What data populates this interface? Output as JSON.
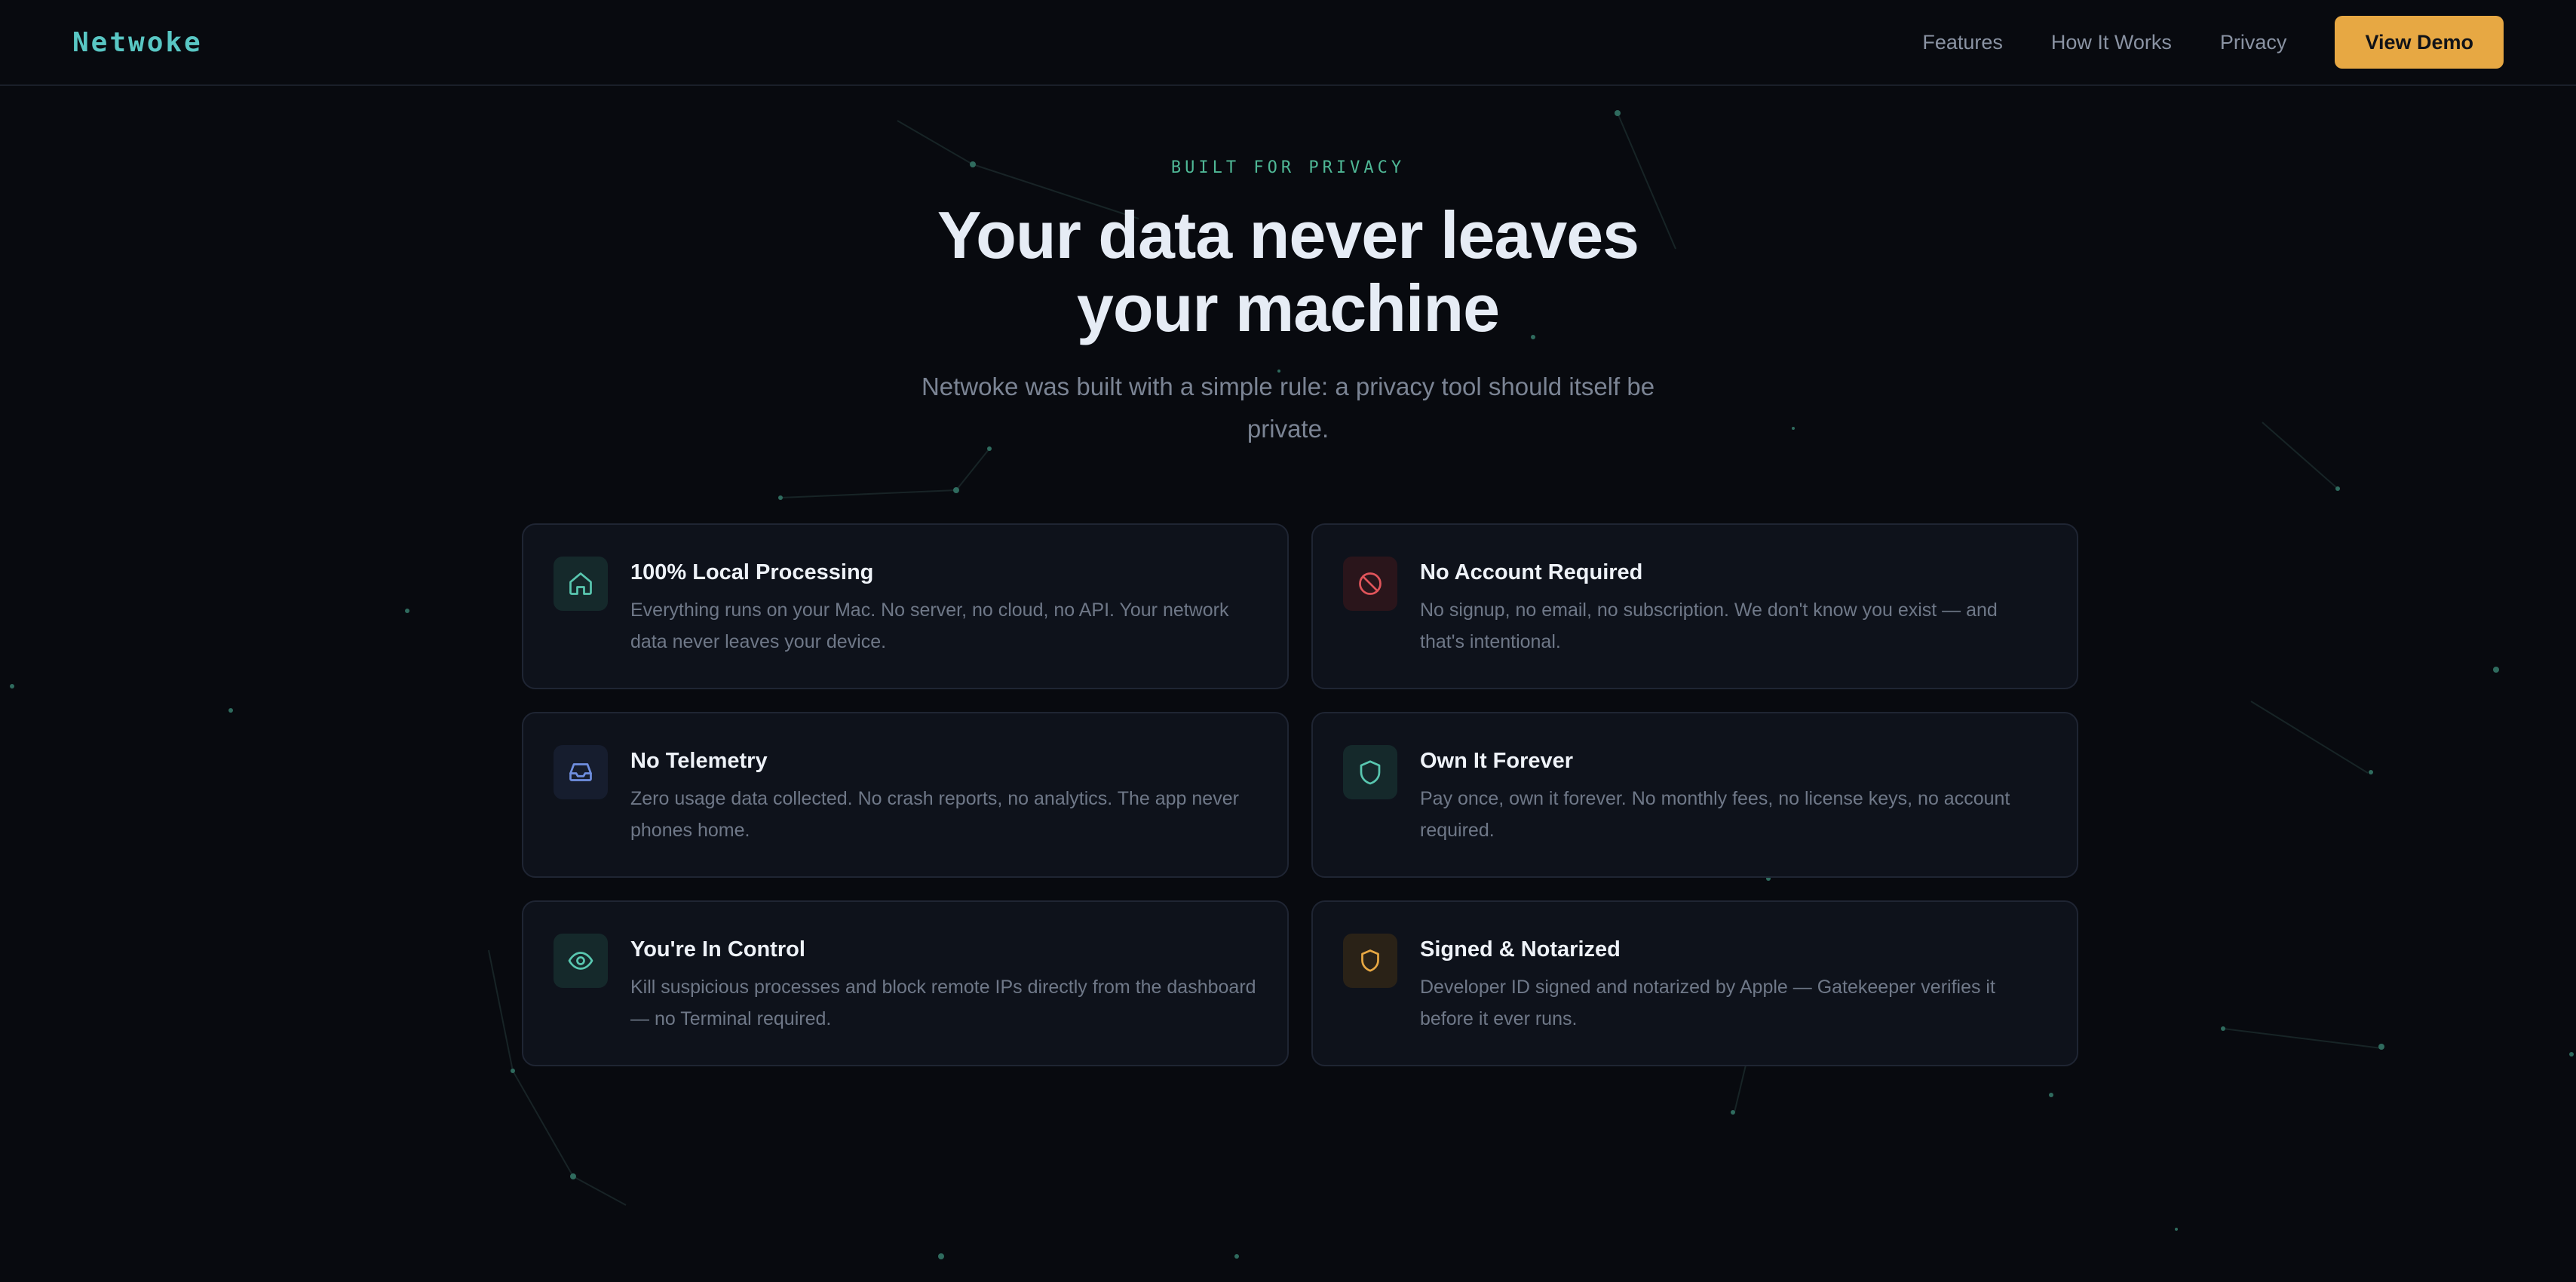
{
  "nav": {
    "logo": "Netwoke",
    "links": [
      "Features",
      "How It Works",
      "Privacy"
    ],
    "cta": "View Demo"
  },
  "hero": {
    "eyebrow": "BUILT FOR PRIVACY",
    "title_line1": "Your data never leaves",
    "title_line2": "your machine",
    "subtitle": "Netwoke was built with a simple rule: a privacy tool should itself be private."
  },
  "colors": {
    "accent_teal": "#59c7c4",
    "accent_green": "#4fb896",
    "cta_orange": "#e7a843",
    "danger_red": "#e0545a",
    "info_blue": "#6f8fe0",
    "background": "#080a0f",
    "card_bg": "#0e121b"
  },
  "cards": [
    {
      "title": "100% Local Processing",
      "desc": "Everything runs on your Mac. No server, no cloud, no API. Your network data never leaves your device.",
      "icon": "home-icon"
    },
    {
      "title": "No Account Required",
      "desc": "No signup, no email, no subscription. We don't know you exist — and that's intentional.",
      "icon": "ban-icon"
    },
    {
      "title": "No Telemetry",
      "desc": "Zero usage data collected. No crash reports, no analytics. The app never phones home.",
      "icon": "inbox-icon"
    },
    {
      "title": "Own It Forever",
      "desc": "Pay once, own it forever. No monthly fees, no license keys, no account required.",
      "icon": "shield-icon"
    },
    {
      "title": "You're In Control",
      "desc": "Kill suspicious processes and block remote IPs directly from the dashboard — no Terminal required.",
      "icon": "eye-icon"
    },
    {
      "title": "Signed & Notarized",
      "desc": "Developer ID signed and notarized by Apple — Gatekeeper verifies it before it ever runs.",
      "icon": "shield-check-icon"
    }
  ]
}
